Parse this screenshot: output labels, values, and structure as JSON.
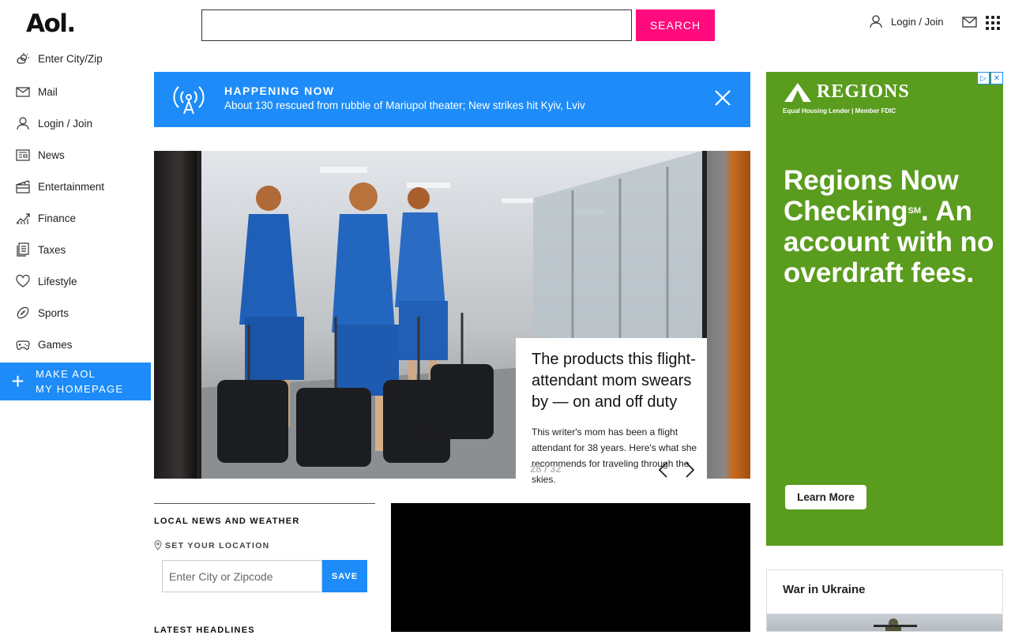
{
  "header": {
    "logo": "Aol.",
    "search_placeholder": "",
    "search_button": "SEARCH",
    "login": "Login / Join"
  },
  "sidebar": {
    "items": [
      {
        "label": "Enter City/Zip",
        "icon": "weather-icon"
      },
      {
        "label": "Mail",
        "icon": "mail-icon"
      },
      {
        "label": "Login / Join",
        "icon": "user-icon"
      },
      {
        "label": "News",
        "icon": "news-icon"
      },
      {
        "label": "Entertainment",
        "icon": "clapper-icon"
      },
      {
        "label": "Finance",
        "icon": "chart-icon"
      },
      {
        "label": "Taxes",
        "icon": "document-icon"
      },
      {
        "label": "Lifestyle",
        "icon": "heart-icon"
      },
      {
        "label": "Sports",
        "icon": "football-icon"
      },
      {
        "label": "Games",
        "icon": "gamepad-icon"
      }
    ],
    "make_home_line1": "MAKE AOL",
    "make_home_line2": "MY HOMEPAGE"
  },
  "happening": {
    "title": "HAPPENING NOW",
    "text": "About 130 rescued from rubble of Mariupol theater; New strikes hit Kyiv, Lviv"
  },
  "carousel": {
    "title": "The products this flight-attendant mom swears by — on and off duty",
    "description": "This writer's mom has been a flight attendant for 38 years. Here's what she recommends for traveling through the skies.",
    "counter": "28 / 32"
  },
  "local": {
    "title": "LOCAL NEWS AND WEATHER",
    "set_location": "SET YOUR LOCATION",
    "city_placeholder": "Enter City or Zipcode",
    "save": "SAVE",
    "latest": "LATEST HEADLINES"
  },
  "ad": {
    "brand": "REGIONS",
    "sub": "Equal Housing Lender | Member FDIC",
    "headline_part1": "Regions Now Checking",
    "headline_sup": "SM",
    "headline_part2": ". An account with no overdraft fees.",
    "cta": "Learn More",
    "colors": {
      "background": "#5a9c1e"
    }
  },
  "war": {
    "title": "War in Ukraine"
  },
  "colors": {
    "accent_blue": "#1d8cf8",
    "search_pink": "#ff0b7d"
  }
}
